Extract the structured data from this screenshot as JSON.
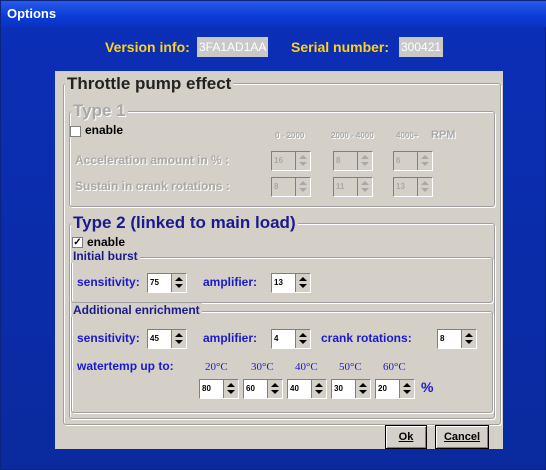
{
  "window": {
    "title": "Options"
  },
  "header": {
    "version_label": "Version info:",
    "version_value": "3FA1AD1AA",
    "serial_label": "Serial number:",
    "serial_value": "300421"
  },
  "throttle": {
    "title": "Throttle pump effect",
    "type1": {
      "title": "Type 1",
      "enable_label": "enable",
      "enabled": false,
      "rpm_headers": [
        "0 - 2000",
        "2000 - 4000",
        "4000+",
        "RPM"
      ],
      "accel_label": "Acceleration amount in % :",
      "accel_values": [
        "16",
        "8",
        "6"
      ],
      "sustain_label": "Sustain in crank rotations :",
      "sustain_values": [
        "8",
        "11",
        "13"
      ]
    },
    "type2": {
      "title": "Type 2 (linked to main load)",
      "enable_label": "enable",
      "enabled": true,
      "initial_burst": {
        "title": "Initial burst",
        "sensitivity_label": "sensitivity:",
        "sensitivity_value": "75",
        "amplifier_label": "amplifier:",
        "amplifier_value": "13"
      },
      "additional": {
        "title": "Additional enrichment",
        "sensitivity_label": "sensitivity:",
        "sensitivity_value": "45",
        "amplifier_label": "amplifier:",
        "amplifier_value": "4",
        "crank_label": "crank rotations:",
        "crank_value": "8",
        "watertemp_label": "watertemp up to:",
        "temps": [
          "20°C",
          "30°C",
          "40°C",
          "50°C",
          "60°C"
        ],
        "temp_values": [
          "80",
          "60",
          "40",
          "30",
          "20"
        ],
        "percent": "%"
      }
    }
  },
  "buttons": {
    "ok": "Ok",
    "cancel": "Cancel"
  }
}
